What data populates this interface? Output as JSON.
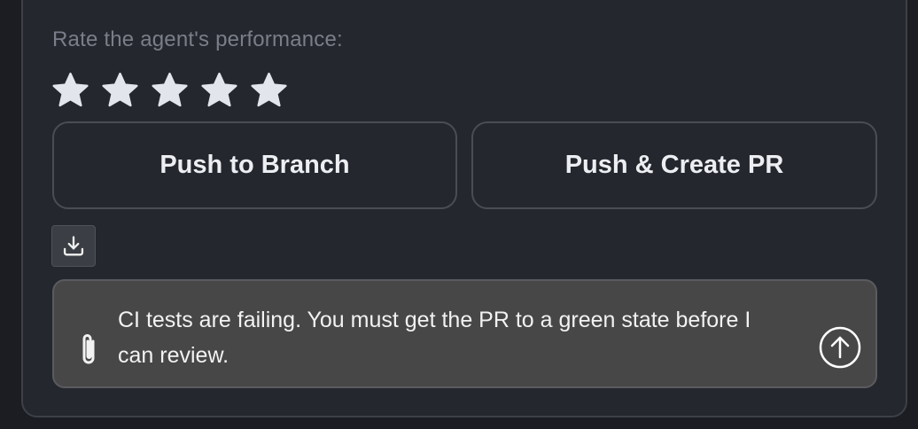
{
  "rating": {
    "label": "Rate the agent's performance:",
    "max_stars": 5,
    "selected": 0,
    "star_color": "#e3e5ec"
  },
  "actions": {
    "push_branch_label": "Push to Branch",
    "push_pr_label": "Push & Create PR"
  },
  "download": {
    "icon": "download-icon"
  },
  "composer": {
    "message": "CI tests are failing. You must get the PR to a green state before I can review.",
    "attach_icon": "paperclip-icon",
    "send_icon": "arrow-up-circle-icon"
  }
}
